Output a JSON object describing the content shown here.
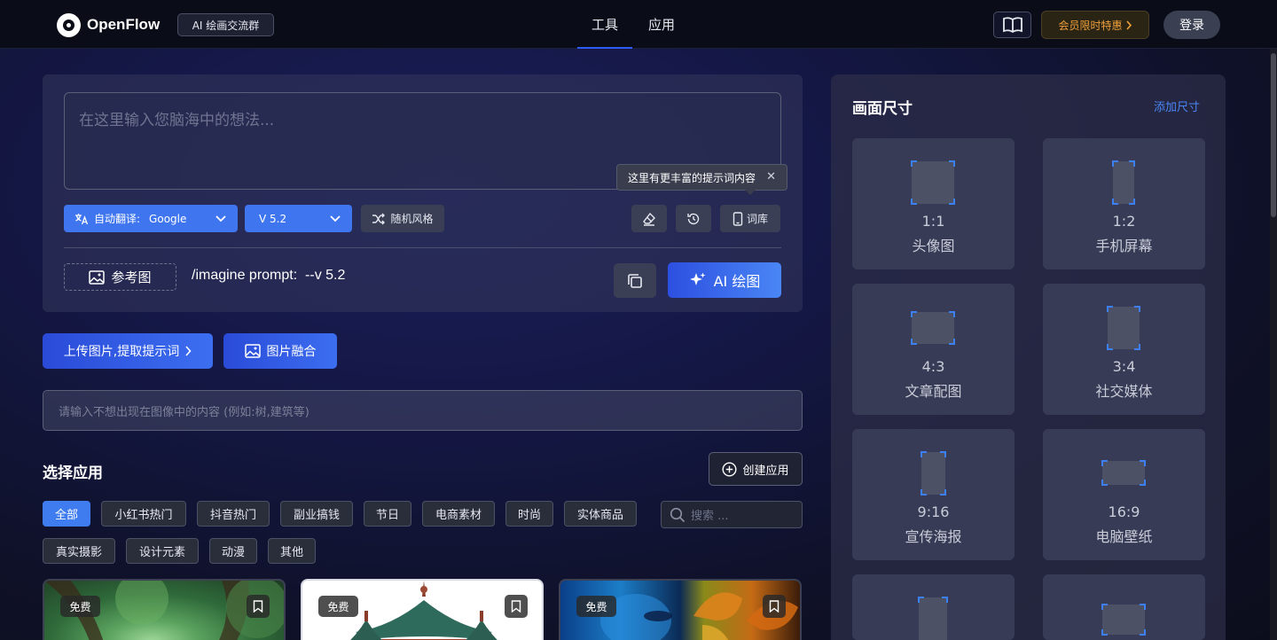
{
  "header": {
    "logo_text": "OpenFlow",
    "group_button": "AI 绘画交流群",
    "tabs": [
      {
        "label": "工具",
        "active": true
      },
      {
        "label": "应用",
        "active": false
      }
    ],
    "vip_label": "会员限时特惠",
    "login_label": "登录"
  },
  "prompt": {
    "placeholder": "在这里输入您脑海中的想法...",
    "tooltip": "这里有更丰富的提示词内容",
    "translate_label": "自动翻译:",
    "translate_value": "Google",
    "version_value": "V 5.2",
    "random_style": "随机风格",
    "lexicon": "词库",
    "reference_image": "参考图",
    "imagine_text": "/imagine prompt:  --v 5.2",
    "ai_draw": "AI 绘图"
  },
  "actions": {
    "upload_extract": "上传图片,提取提示词",
    "image_fusion": "图片融合",
    "negative_placeholder": "请输入不想出现在图像中的内容 (例如:树,建筑等)"
  },
  "apps": {
    "title": "选择应用",
    "create_label": "创建应用",
    "search_placeholder": "搜索 ...",
    "categories": [
      "全部",
      "小红书热门",
      "抖音热门",
      "副业搞钱",
      "节日",
      "电商素材",
      "时尚",
      "实体商品",
      "真实摄影",
      "设计元素",
      "动漫",
      "其他"
    ],
    "active_category": "全部",
    "cards": [
      {
        "badge": "免费"
      },
      {
        "badge": "免费"
      },
      {
        "badge": "免费"
      }
    ]
  },
  "canvas_size": {
    "title": "画面尺寸",
    "add_label": "添加尺寸",
    "options": [
      {
        "ratio": "1:1",
        "label": "头像图"
      },
      {
        "ratio": "1:2",
        "label": "手机屏幕"
      },
      {
        "ratio": "4:3",
        "label": "文章配图"
      },
      {
        "ratio": "3:4",
        "label": "社交媒体"
      },
      {
        "ratio": "9:16",
        "label": "宣传海报"
      },
      {
        "ratio": "16:9",
        "label": "电脑壁纸"
      }
    ]
  },
  "colors": {
    "accent": "#3f7cf0",
    "vip": "#f0a13a"
  }
}
